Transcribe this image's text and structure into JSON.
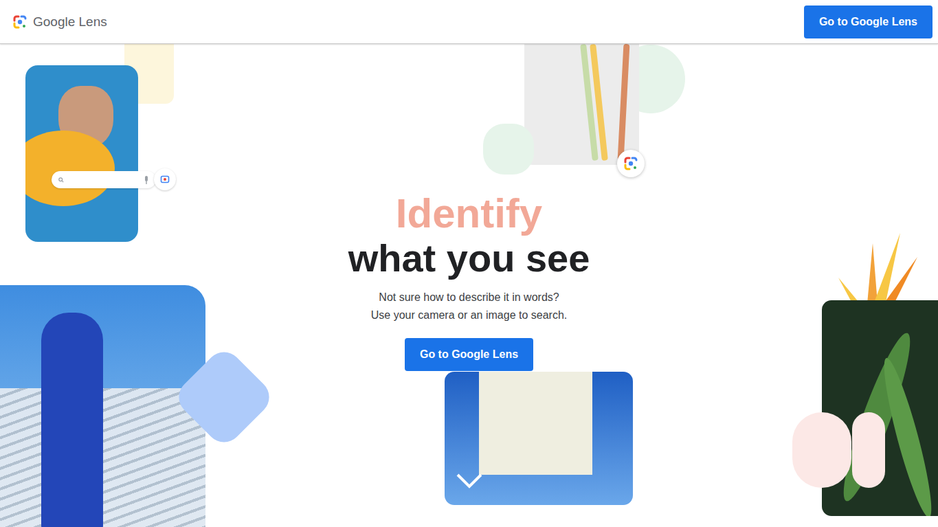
{
  "header": {
    "logo_text": "Google Lens",
    "cta": "Go to Google Lens"
  },
  "hero": {
    "highlight": "Identify",
    "title": "what you see",
    "subtitle_lines": [
      "Not sure how to describe it in words?",
      "Use your camera or an image to search."
    ],
    "cta": "Go to Google Lens"
  }
}
